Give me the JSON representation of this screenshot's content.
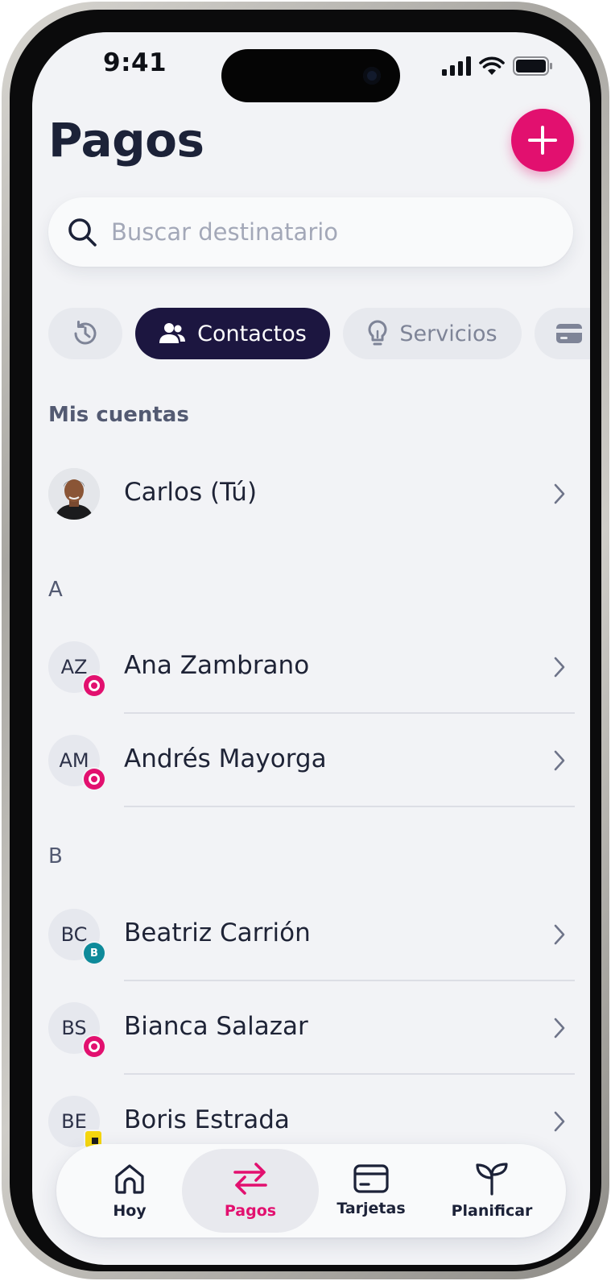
{
  "status_bar": {
    "time": "9:41"
  },
  "header": {
    "title": "Pagos",
    "add_icon": "plus-icon"
  },
  "search": {
    "placeholder": "Buscar destinatario",
    "icon": "search-icon"
  },
  "tabs": [
    {
      "label": "",
      "icon": "history-icon",
      "selected": false
    },
    {
      "label": "Contactos",
      "icon": "users-icon",
      "selected": true
    },
    {
      "label": "Servicios",
      "icon": "lightbulb-icon",
      "selected": false
    },
    {
      "label": "",
      "icon": "card-icon",
      "selected": false
    }
  ],
  "my_accounts": {
    "header": "Mis cuentas",
    "items": [
      {
        "name": "Carlos (Tú)",
        "avatar": "photo"
      }
    ]
  },
  "sections": [
    {
      "letter": "A",
      "contacts": [
        {
          "initials": "AZ",
          "name": "Ana Zambrano",
          "bank_badge": "pink"
        },
        {
          "initials": "AM",
          "name": "Andrés Mayorga",
          "bank_badge": "pink"
        }
      ]
    },
    {
      "letter": "B",
      "contacts": [
        {
          "initials": "BC",
          "name": "Beatriz Carrión",
          "bank_badge": "teal",
          "badge_text": "B"
        },
        {
          "initials": "BS",
          "name": "Bianca Salazar",
          "bank_badge": "pink"
        },
        {
          "initials": "BE",
          "name": "Boris Estrada",
          "bank_badge": "yellow"
        }
      ]
    }
  ],
  "bottom_nav": [
    {
      "label": "Hoy",
      "icon": "home-icon",
      "active": false
    },
    {
      "label": "Pagos",
      "icon": "transfer-arrows-icon",
      "active": true
    },
    {
      "label": "Tarjetas",
      "icon": "card-icon",
      "active": false
    },
    {
      "label": "Planificar",
      "icon": "sprout-icon",
      "active": false
    }
  ],
  "colors": {
    "accent": "#e2106f",
    "selected_tab": "#1c1640",
    "title": "#1c2238",
    "background": "#f2f3f6",
    "teal_badge": "#0e8a9a",
    "yellow_badge": "#f5d60e"
  }
}
